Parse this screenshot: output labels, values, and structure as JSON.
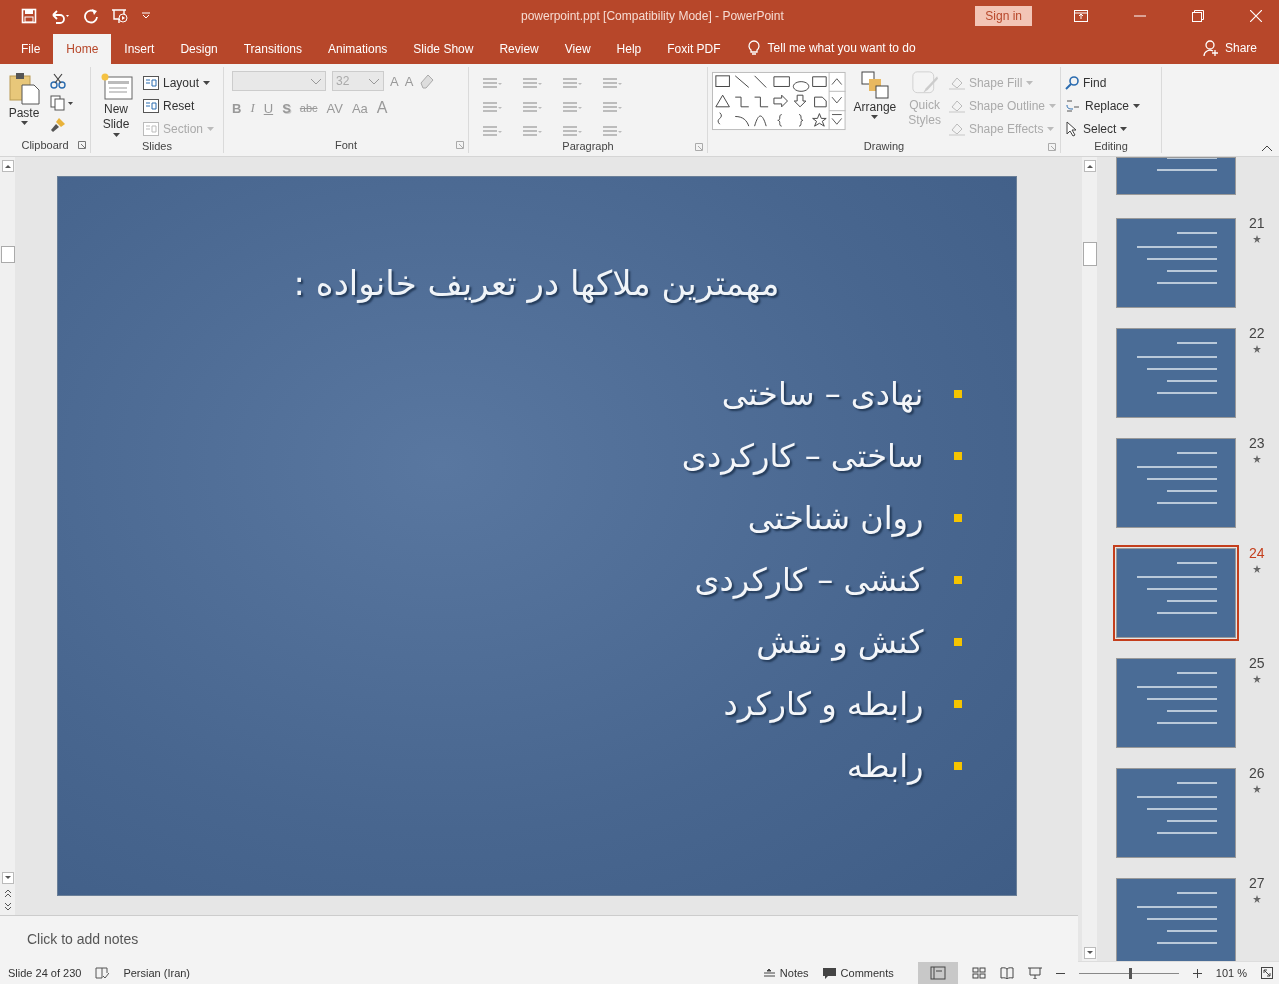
{
  "title_bar": {
    "title": "powerpoint.ppt [Compatibility Mode]  -  PowerPoint",
    "sign_in": "Sign in"
  },
  "tabs": [
    {
      "label": "File",
      "selected": false
    },
    {
      "label": "Home",
      "selected": true
    },
    {
      "label": "Insert",
      "selected": false
    },
    {
      "label": "Design",
      "selected": false
    },
    {
      "label": "Transitions",
      "selected": false
    },
    {
      "label": "Animations",
      "selected": false
    },
    {
      "label": "Slide Show",
      "selected": false
    },
    {
      "label": "Review",
      "selected": false
    },
    {
      "label": "View",
      "selected": false
    },
    {
      "label": "Help",
      "selected": false
    },
    {
      "label": "Foxit PDF",
      "selected": false
    }
  ],
  "tell_me": "Tell me what you want to do",
  "share": "Share",
  "ribbon": {
    "clipboard": {
      "label": "Clipboard",
      "paste": "Paste"
    },
    "slides": {
      "label": "Slides",
      "new_slide": [
        "New",
        "Slide"
      ],
      "items": [
        {
          "label": "Layout",
          "disabled": false
        },
        {
          "label": "Reset",
          "disabled": false
        },
        {
          "label": "Section",
          "disabled": true
        }
      ]
    },
    "font": {
      "label": "Font",
      "size": "32",
      "grow": "A",
      "shrink": "A",
      "format": [
        "B",
        "I",
        "U",
        "S",
        "abc",
        "AV",
        "Aa",
        "A"
      ]
    },
    "paragraph": {
      "label": "Paragraph"
    },
    "drawing": {
      "label": "Drawing",
      "arrange": "Arrange",
      "quick_styles": [
        "Quick",
        "Styles"
      ],
      "items": [
        {
          "label": "Shape Fill",
          "disabled": true
        },
        {
          "label": "Shape Outline",
          "disabled": true
        },
        {
          "label": "Shape Effects",
          "disabled": true
        }
      ]
    },
    "editing": {
      "label": "Editing",
      "items": [
        {
          "label": "Find",
          "disabled": false
        },
        {
          "label": "Replace",
          "disabled": false
        },
        {
          "label": "Select",
          "disabled": false
        }
      ]
    }
  },
  "slide": {
    "title": "مهمترین ملاکها در تعریف خانواده :",
    "bullets": [
      "نهادی – ساختی",
      "ساختی – کارکردی",
      "روان شناختی",
      "کنشی – کارکردی",
      "کنش و نقش",
      "رابطه و کارکرد",
      "رابطه"
    ]
  },
  "notes_placeholder": "Click to add notes",
  "thumbnails": [
    {
      "selected": false
    },
    {
      "number": "21",
      "selected": false
    },
    {
      "number": "22",
      "selected": false
    },
    {
      "number": "23",
      "selected": false
    },
    {
      "number": "24",
      "selected": true
    },
    {
      "number": "25",
      "selected": false
    },
    {
      "number": "26",
      "selected": false
    },
    {
      "number": "27",
      "selected": false
    }
  ],
  "status_bar": {
    "slide": "Slide 24 of 230",
    "language": "Persian (Iran)",
    "notes": "Notes",
    "comments": "Comments",
    "zoom": {
      "level": 0.5
    },
    "zoom_reading": "101 %"
  }
}
